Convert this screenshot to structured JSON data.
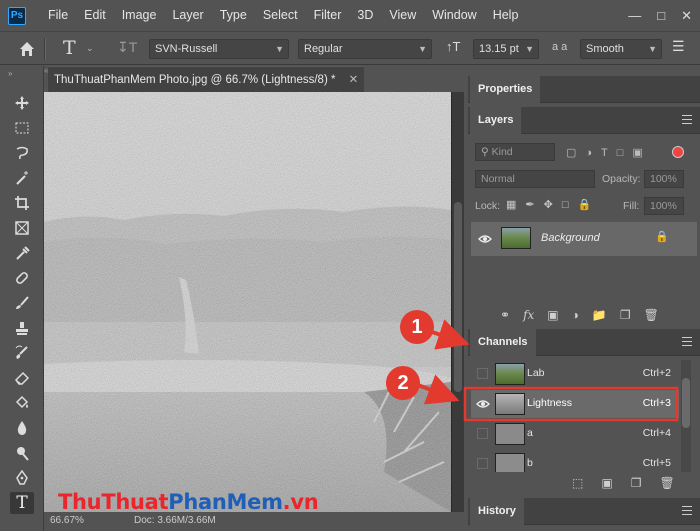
{
  "menubar": {
    "logo": "Ps",
    "items": [
      "File",
      "Edit",
      "Image",
      "Layer",
      "Type",
      "Select",
      "Filter",
      "3D",
      "View",
      "Window",
      "Help"
    ]
  },
  "options": {
    "font_family": "SVN-Russell",
    "font_style": "Regular",
    "font_size": "13.15 pt",
    "aa_label": "a a",
    "antialias": "Smooth"
  },
  "document": {
    "tab_title": "ThuThuatPhanMem Photo.jpg @ 66.7% (Lightness/8) *",
    "zoom": "66.67%",
    "doc_info": "Doc: 3.66M/3.66M"
  },
  "panels": {
    "properties": "Properties",
    "layers": {
      "title": "Layers",
      "kind_label": "Kind",
      "blend_mode": "Normal",
      "opacity_label": "Opacity:",
      "opacity_value": "100%",
      "lock_label": "Lock:",
      "fill_label": "Fill:",
      "fill_value": "100%",
      "layer_name": "Background"
    },
    "channels": {
      "title": "Channels",
      "items": [
        {
          "name": "Lab",
          "shortcut": "Ctrl+2"
        },
        {
          "name": "Lightness",
          "shortcut": "Ctrl+3"
        },
        {
          "name": "a",
          "shortcut": "Ctrl+4"
        },
        {
          "name": "b",
          "shortcut": "Ctrl+5"
        }
      ]
    },
    "history": "History"
  },
  "annotations": {
    "callout1": "1",
    "callout2": "2",
    "accent": "#e23a2e"
  },
  "watermark": {
    "part1": "ThuThuat",
    "part2": "PhanMem",
    "part3": ".vn"
  }
}
